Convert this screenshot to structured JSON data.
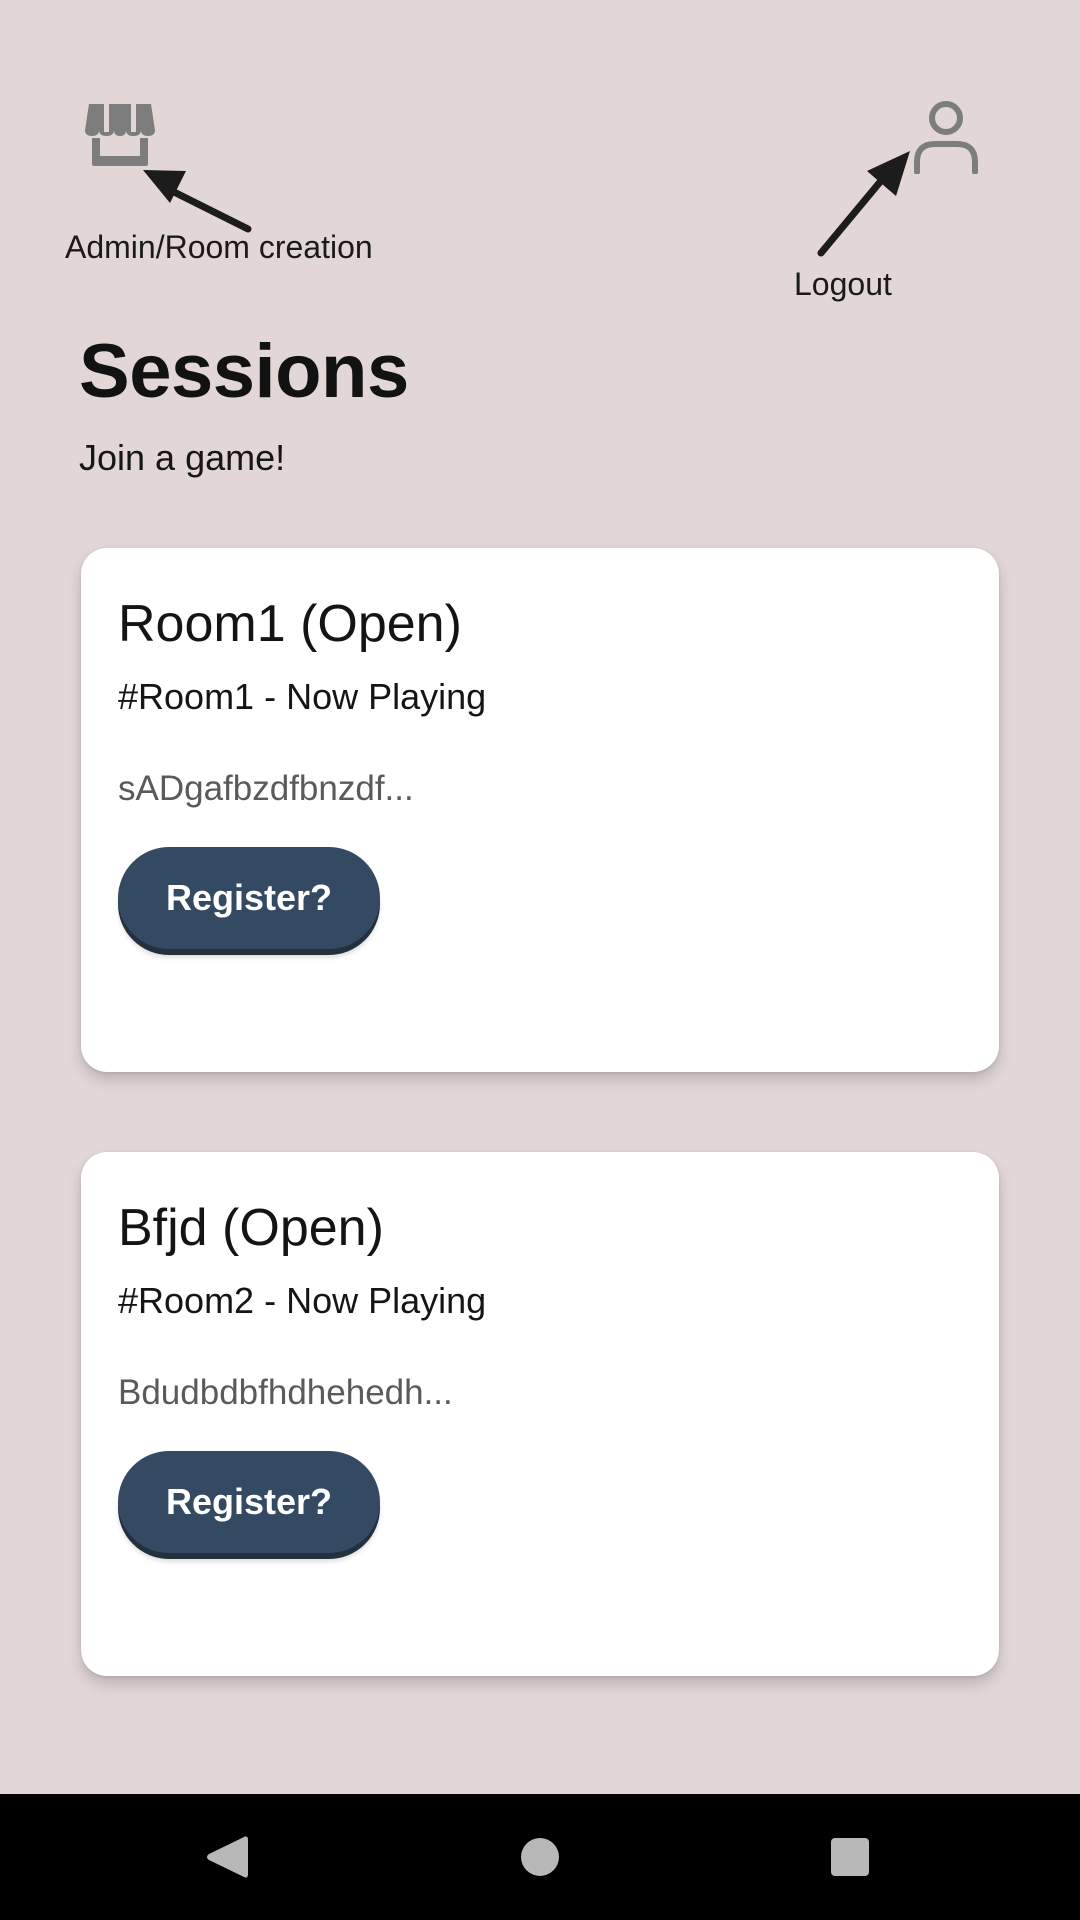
{
  "header": {
    "admin_icon": "storefront-icon",
    "profile_icon": "person-icon",
    "icon_color": "#7a7a7a"
  },
  "annotations": {
    "admin_label": "Admin/Room creation",
    "logout_label": "Logout"
  },
  "main": {
    "title": "Sessions",
    "subtitle": "Join a game!"
  },
  "rooms": [
    {
      "title": "Room1 (Open)",
      "subtitle": "#Room1 - Now Playing",
      "description": "sADgafbzdfbnzdf...",
      "button_label": "Register?"
    },
    {
      "title": "Bfjd (Open)",
      "subtitle": "#Room2 - Now Playing",
      "description": "Bdudbdbfhdhehedh...",
      "button_label": "Register?"
    }
  ],
  "colors": {
    "background": "#e2d6d7",
    "button": "#344a63",
    "card": "#ffffff"
  },
  "navbar": {
    "icons": [
      "back-triangle-icon",
      "home-circle-icon",
      "recents-square-icon"
    ]
  }
}
